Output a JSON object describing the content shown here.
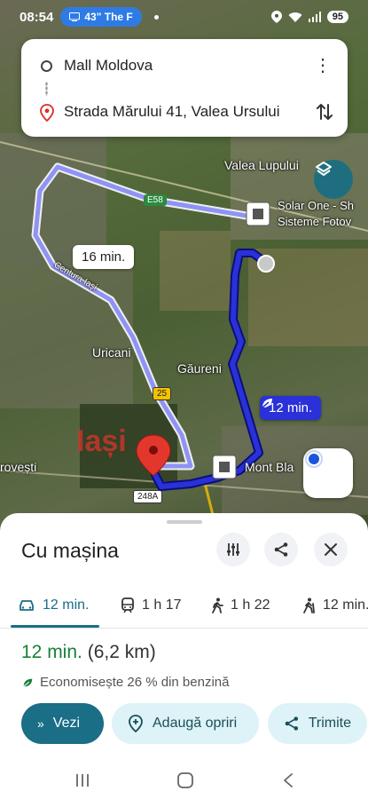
{
  "status_bar": {
    "time": "08:54",
    "notification": "43\" The F",
    "battery": "95"
  },
  "route": {
    "origin": "Mall Moldova",
    "destination": "Strada Mărului 41, Valea Ursului"
  },
  "map": {
    "labels": {
      "valea_lupului": "Valea Lupului",
      "solar_one_line1": "Solar One - Sh",
      "solar_one_line2": "Sisteme Fotov",
      "centura": "Centura Iași",
      "uricani": "Uricani",
      "gaureni": "Găureni",
      "rovesti": "rovești",
      "mont_blanc": "Mont Bla",
      "iasi": "Iași"
    },
    "roads": {
      "e58": "E58",
      "r25": "25",
      "r248a": "248A"
    },
    "alt_route_time": "16 min.",
    "main_route_time": "12 min."
  },
  "sheet": {
    "title": "Cu mașina",
    "modes": [
      {
        "label": "12 min.",
        "icon": "car-icon"
      },
      {
        "label": "1 h 17",
        "icon": "train-icon"
      },
      {
        "label": "1 h 22",
        "icon": "walk-icon"
      },
      {
        "label": "12 min.",
        "icon": "hike-icon"
      }
    ],
    "summary_time": "12 min.",
    "summary_distance": "(6,2 km)",
    "eco_text": "Economisește 26 % din benzină",
    "buttons": {
      "start": "Vezi",
      "add_stops": "Adaugă opriri",
      "send": "Trimite"
    }
  },
  "colors": {
    "accent": "#1a6e86",
    "route_main": "#2a31d8",
    "route_alt": "#8f93f5",
    "eco_green": "#188038"
  }
}
